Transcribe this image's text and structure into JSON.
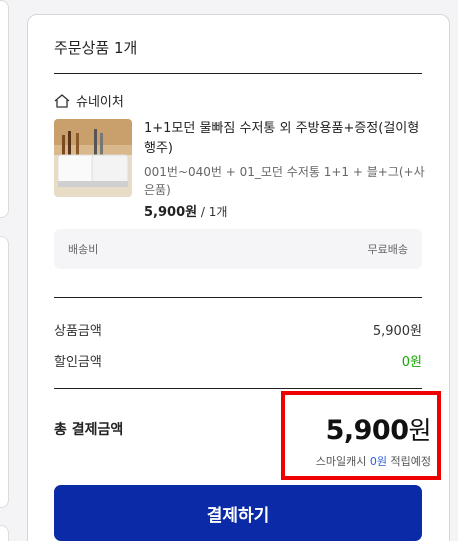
{
  "order": {
    "title": "주문상품 1개",
    "seller": "슈네이처",
    "product": {
      "name": "1+1모던 물빠짐 수저통 외 주방용품+증정(걸이형행주)",
      "option": "001번~040번 + 01_모던 수저통 1+1 + 블+그(+사은품)",
      "price": "5,900원",
      "qty": " / 1개"
    },
    "shipping": {
      "label": "배송비",
      "value": "무료배송"
    }
  },
  "summary": {
    "product_amount_label": "상품금액",
    "product_amount": "5,900원",
    "discount_label": "할인금액",
    "discount": "0원",
    "total_label": "총 결제금액",
    "total_number": "5,900",
    "total_unit": "원",
    "smilecash_prefix": "스마일캐시 ",
    "smilecash_amount": "0원",
    "smilecash_suffix": " 적립예정"
  },
  "pay_button": "결제하기",
  "colors": {
    "primary": "#0a2aa8",
    "highlight": "#ee0000",
    "discount": "#14a800",
    "smilecash": "#2a5bd7"
  },
  "icons": {
    "seller": "home-icon",
    "product": "product-thumbnail"
  }
}
